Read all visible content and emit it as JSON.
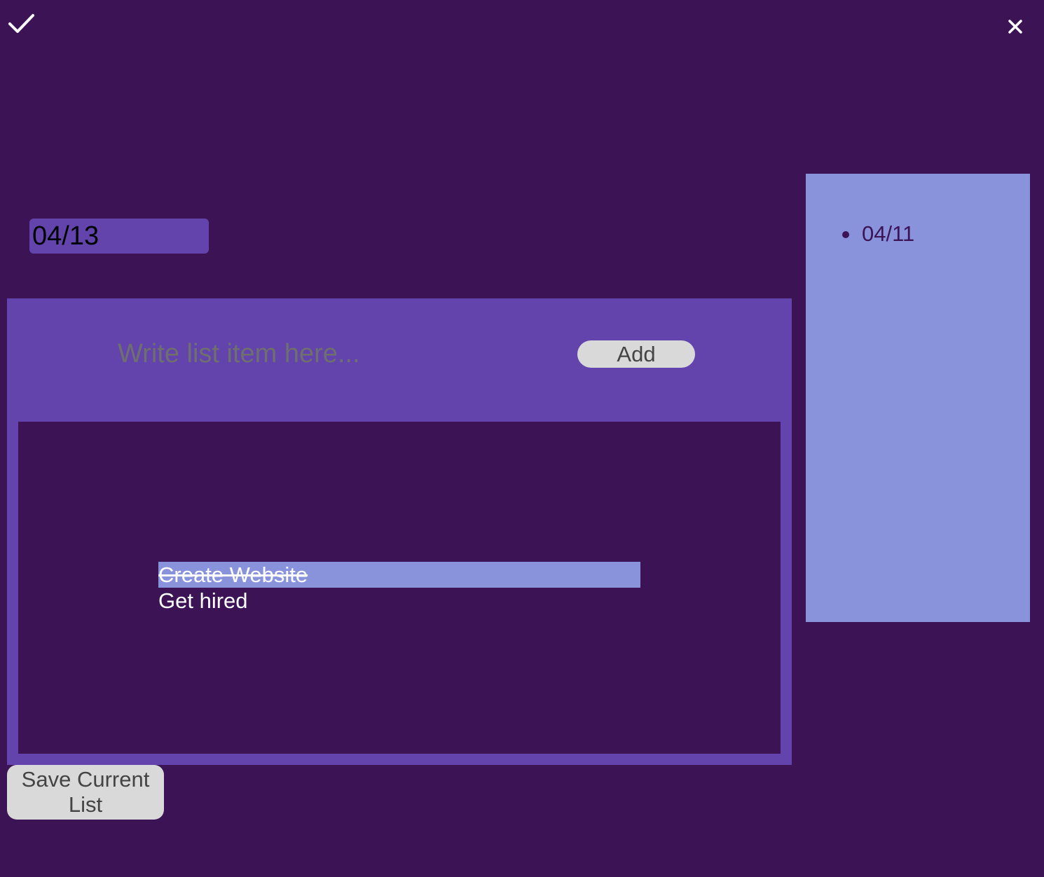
{
  "toolbar": {
    "check_icon": "check-icon",
    "close_icon": "close-icon"
  },
  "date_field": {
    "value": "04/13"
  },
  "new_item": {
    "placeholder": "Write list item here...",
    "value": "",
    "add_label": "Add"
  },
  "items": [
    {
      "text": "Create Website",
      "completed": true
    },
    {
      "text": "Get hired",
      "completed": false
    }
  ],
  "save_button": {
    "label": "Save Current List"
  },
  "saved_lists": [
    {
      "label": "04/11"
    }
  ],
  "colors": {
    "background": "#3c1456",
    "panel": "#6244ac",
    "sidebar": "#8893dc",
    "completed_highlight": "#8893dc",
    "button": "#d9d9d9"
  }
}
